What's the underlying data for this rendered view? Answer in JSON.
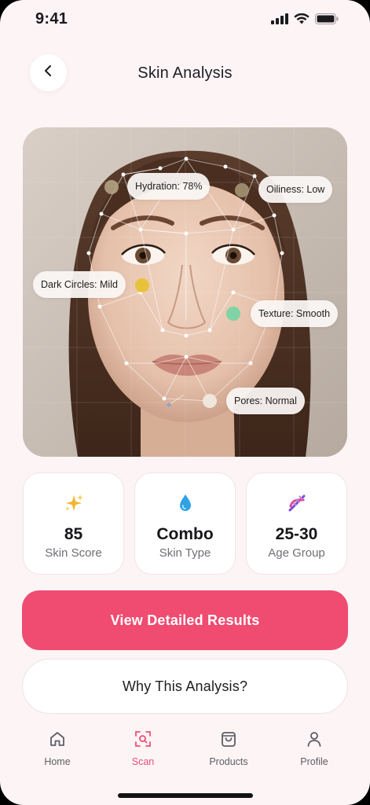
{
  "status": {
    "time": "9:41"
  },
  "header": {
    "title": "Skin Analysis"
  },
  "analysis_tags": {
    "hydration": "Hydration: 78%",
    "oiliness": "Oiliness: Low",
    "dark_circles": "Dark Circles: Mild",
    "texture": "Texture: Smooth",
    "pores": "Pores: Normal"
  },
  "stats": [
    {
      "icon": "sparkles-icon",
      "value": "85",
      "label": "Skin Score"
    },
    {
      "icon": "droplet-icon",
      "value": "Combo",
      "label": "Skin Type"
    },
    {
      "icon": "dna-icon",
      "value": "25-30",
      "label": "Age Group"
    }
  ],
  "actions": {
    "primary": "View Detailed Results",
    "secondary": "Why This Analysis?"
  },
  "nav": [
    {
      "icon": "home-icon",
      "label": "Home",
      "active": false
    },
    {
      "icon": "scan-icon",
      "label": "Scan",
      "active": true
    },
    {
      "icon": "shopping-bag-icon",
      "label": "Products",
      "active": false
    },
    {
      "icon": "user-icon",
      "label": "Profile",
      "active": false
    }
  ],
  "colors": {
    "accent": "#f04b71",
    "background": "#fdf4f6",
    "dot_hydration": "#b8a888",
    "dot_oiliness": "#a89a78",
    "dot_dark_circles": "#e8c33a",
    "dot_texture": "#7fd3a4",
    "dot_pores": "#efe6dc"
  }
}
